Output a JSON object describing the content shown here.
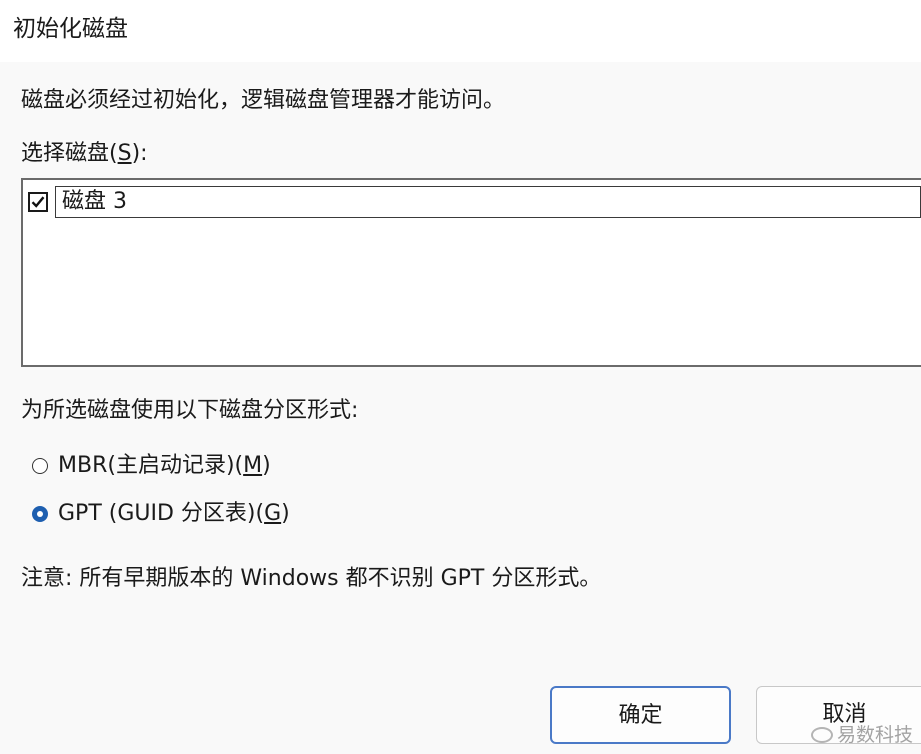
{
  "window": {
    "title": "初始化磁盘"
  },
  "intro_text": "磁盘必须经过初始化，逻辑磁盘管理器才能访问。",
  "select_disk": {
    "label_prefix": "选择磁盘(",
    "label_mnemonic": "S",
    "label_suffix": "):",
    "items": [
      {
        "label": "磁盘 3",
        "checked": true
      }
    ]
  },
  "partition_style": {
    "label": "为所选磁盘使用以下磁盘分区形式:",
    "options": [
      {
        "label_prefix": "MBR(主启动记录)(",
        "mnemonic": "M",
        "label_suffix": ")",
        "selected": false
      },
      {
        "label_prefix": "GPT (GUID 分区表)(",
        "mnemonic": "G",
        "label_suffix": ")",
        "selected": true
      }
    ]
  },
  "note": "注意: 所有早期版本的 Windows 都不识别 GPT 分区形式。",
  "buttons": {
    "ok": "确定",
    "cancel": "取消"
  },
  "watermark": "易数科技",
  "colors": {
    "accent": "#1e5fb0",
    "primary_button_border": "#4a79c7",
    "background": "#f9f9f9"
  }
}
